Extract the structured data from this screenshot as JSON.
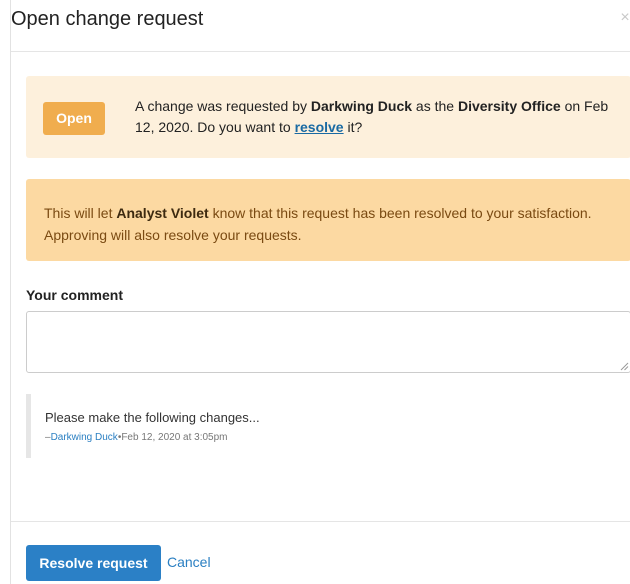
{
  "modal": {
    "title": "Open change request",
    "close_icon": "×"
  },
  "status": {
    "badge": "Open",
    "prefix": "A change was requested by ",
    "requester": "Darkwing Duck",
    "middle": " as the ",
    "office": "Diversity Office",
    "suffix": " on Feb 12, 2020. Do you want to ",
    "resolve_link": "resolve",
    "end": " it?"
  },
  "warning": {
    "prefix": "This will let ",
    "analyst": "Analyst Violet",
    "suffix": " know that this request has been resolved to your satisfaction. Approving will also resolve your requests."
  },
  "comment": {
    "label": "Your comment",
    "value": "",
    "placeholder": ""
  },
  "quote": {
    "text": "Please make the following changes...",
    "dash": "–",
    "author": "Darkwing Duck",
    "separator": "•",
    "timestamp": "Feb 12, 2020 at 3:05pm"
  },
  "footer": {
    "resolve_label": "Resolve request",
    "cancel_label": "Cancel"
  },
  "colors": {
    "badge": "#f0ad4e",
    "status_bg": "#fdf0dc",
    "warning_bg": "#fcd9a2",
    "primary": "#2b80c6",
    "link": "#1a6aa3"
  }
}
